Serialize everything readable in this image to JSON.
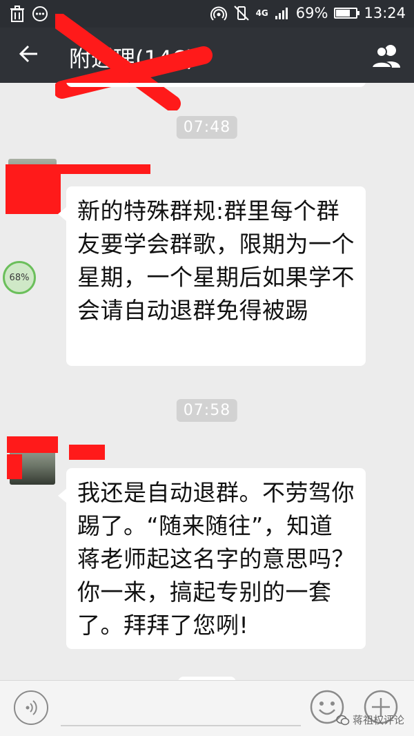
{
  "status_bar": {
    "network": "4G",
    "battery_text": "69%",
    "battery_level": 0.69,
    "time": "13:24",
    "icons": [
      "trash-icon",
      "chat-bubble-icon",
      "hotspot-icon",
      "vibrate-icon",
      "signal-icon",
      "battery-icon"
    ]
  },
  "header": {
    "title": "附近理(146)",
    "icons": [
      "back-arrow-icon",
      "group-members-icon"
    ]
  },
  "messages": [
    {
      "time": "07:48",
      "text": "新的特殊群规:群里每个群友要学会群歌，限期为一个星期，一个星期后如果学不会请自动退群免得被踢"
    },
    {
      "time": "07:58",
      "text": "我还是自动退群。不劳驾你踢了。“随来随往”，知道蒋老师起这名字的意思吗？你一来，搞起专别的一套了。拜拜了您咧!"
    }
  ],
  "floating_progress": "68%",
  "input_bar": {
    "icons": [
      "voice-icon",
      "emoji-icon",
      "plus-icon"
    ]
  },
  "watermark": "蒋祖权评论",
  "colors": {
    "status_bar": "#2b2e33",
    "title_bar": "#2f3237",
    "chat_background": "#ececec",
    "bubble": "#ffffff",
    "redaction_red": "#ff1a1a",
    "timestamp_bg": "#d2d2d2"
  }
}
